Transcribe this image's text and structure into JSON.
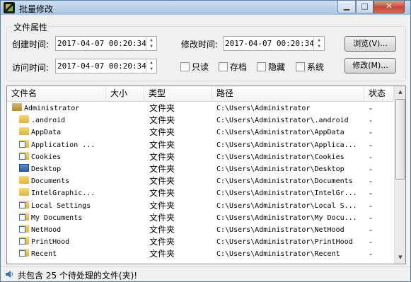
{
  "window": {
    "title": "批量修改"
  },
  "attributes": {
    "group_title": "文件属性",
    "created_label": "创建时间:",
    "created_value": "2017-04-07 00:20:34",
    "modified_label": "修改时间:",
    "modified_value": "2017-04-07 00:20:34",
    "accessed_label": "访问时间:",
    "accessed_value": "2017-04-07 00:20:34",
    "browse_button": "浏览(V)...",
    "modify_button": "修改(M)...",
    "checkboxes": {
      "readonly": "只读",
      "archive": "存档",
      "hidden": "隐藏",
      "system": "系统"
    }
  },
  "list": {
    "columns": {
      "name": "文件名",
      "size": "大小",
      "type": "类型",
      "path": "路径",
      "status": "状态"
    },
    "rows": [
      {
        "name": "Administrator",
        "type": "文件夹",
        "path": "C:\\Users\\Administrator",
        "status": "-",
        "icon": "user-folder-icon"
      },
      {
        "name": ".android",
        "type": "文件夹",
        "path": "C:\\Users\\Administrator\\.android",
        "status": "-",
        "icon": "folder-icon"
      },
      {
        "name": "AppData",
        "type": "文件夹",
        "path": "C:\\Users\\Administrator\\AppData",
        "status": "-",
        "icon": "folder-icon"
      },
      {
        "name": "Application ...",
        "type": "文件夹",
        "path": "C:\\Users\\Administrator\\Applica...",
        "status": "-",
        "icon": "shortcut-folder-icon"
      },
      {
        "name": "Cookies",
        "type": "文件夹",
        "path": "C:\\Users\\Administrator\\Cookies",
        "status": "-",
        "icon": "shortcut-folder-icon"
      },
      {
        "name": "Desktop",
        "type": "文件夹",
        "path": "C:\\Users\\Administrator\\Desktop",
        "status": "-",
        "icon": "desktop-icon"
      },
      {
        "name": "Documents",
        "type": "文件夹",
        "path": "C:\\Users\\Administrator\\Documents",
        "status": "-",
        "icon": "folder-icon"
      },
      {
        "name": "IntelGraphic...",
        "type": "文件夹",
        "path": "C:\\Users\\Administrator\\IntelGr...",
        "status": "-",
        "icon": "folder-icon"
      },
      {
        "name": "Local Settings",
        "type": "文件夹",
        "path": "C:\\Users\\Administrator\\Local S...",
        "status": "-",
        "icon": "shortcut-folder-icon"
      },
      {
        "name": "My Documents",
        "type": "文件夹",
        "path": "C:\\Users\\Administrator\\My Docu...",
        "status": "-",
        "icon": "shortcut-folder-icon"
      },
      {
        "name": "NetHood",
        "type": "文件夹",
        "path": "C:\\Users\\Administrator\\NetHood",
        "status": "-",
        "icon": "shortcut-folder-icon"
      },
      {
        "name": "PrintHood",
        "type": "文件夹",
        "path": "C:\\Users\\Administrator\\PrintHood",
        "status": "-",
        "icon": "shortcut-folder-icon"
      },
      {
        "name": "Recent",
        "type": "文件夹",
        "path": "C:\\Users\\Administrator\\Recent",
        "status": "-",
        "icon": "shortcut-folder-icon"
      }
    ]
  },
  "status": {
    "text": "共包含 25 个待处理的文件(夹)!"
  }
}
